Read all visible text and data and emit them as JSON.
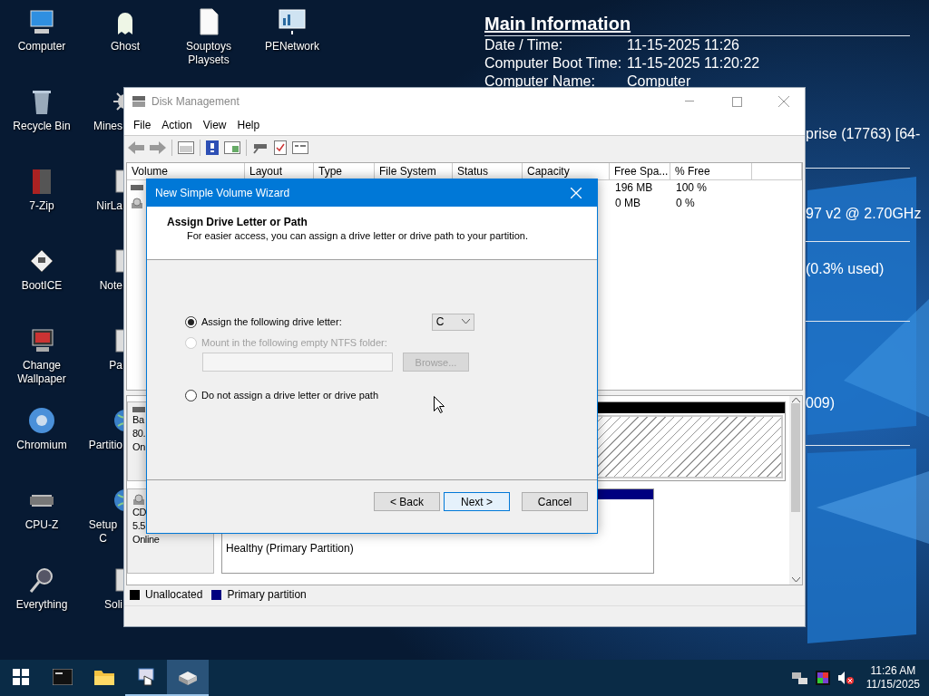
{
  "desktop_columns": [
    {
      "icons": [
        {
          "label": "Computer",
          "kind": "monitor",
          "covered": false
        },
        {
          "label": "Recycle Bin",
          "kind": "bin",
          "covered": false
        },
        {
          "label": "7-Zip",
          "kind": "archive",
          "covered": false
        },
        {
          "label": "BootICE",
          "kind": "floppy",
          "covered": false
        },
        {
          "label": "Change Wallpaper",
          "kind": "wallpaper",
          "covered": false
        },
        {
          "label": "Chromium",
          "kind": "browser",
          "covered": false
        },
        {
          "label": "CPU-Z",
          "kind": "chip",
          "covered": false
        },
        {
          "label": "Everything",
          "kind": "magnifier",
          "covered": false
        }
      ]
    },
    {
      "icons": [
        {
          "label": "Ghost",
          "kind": "ghost",
          "covered": false
        },
        {
          "label": "Mines",
          "kind": "mine",
          "covered": true
        },
        {
          "label": "NirLa",
          "kind": "app",
          "covered": true
        },
        {
          "label": "Note",
          "kind": "app",
          "covered": true
        },
        {
          "label": "Pa",
          "kind": "app",
          "covered": true
        },
        {
          "label": "Partitio",
          "kind": "globe",
          "covered": true
        },
        {
          "label": "Setup C",
          "kind": "globe",
          "covered": true
        },
        {
          "label": "Soli",
          "kind": "app",
          "covered": true
        }
      ]
    },
    {
      "icons": [
        {
          "label": "Souptoys Playsets",
          "kind": "document",
          "covered": false
        }
      ]
    },
    {
      "icons": [
        {
          "label": "PENetwork",
          "kind": "network",
          "covered": false
        }
      ]
    }
  ],
  "info": {
    "title": "Main Information",
    "rows": [
      {
        "label": "Date / Time:",
        "value": "11-15-2025 11:26"
      },
      {
        "label": "Computer Boot Time:",
        "value": "11-15-2025 11:20:22"
      },
      {
        "label": "Computer Name:",
        "value": "Computer"
      }
    ],
    "fragments": [
      "prise (17763) [64-",
      "97 v2 @ 2.70GHz",
      "(0.3% used)",
      "009)"
    ]
  },
  "disk_management": {
    "title": "Disk Management",
    "menu": [
      "File",
      "Action",
      "View",
      "Help"
    ],
    "columns": [
      "Volume",
      "Layout",
      "Type",
      "File System",
      "Status",
      "Capacity",
      "Free Spa...",
      "% Free"
    ],
    "rows": [
      {
        "kind": "disk",
        "free_space": "196 MB",
        "percent_free": "100 %"
      },
      {
        "kind": "cdrom",
        "free_space": "0 MB",
        "percent_free": "0 %"
      }
    ],
    "disks": [
      {
        "kind": "disk",
        "lines": [
          "Ba",
          "80.",
          "On"
        ],
        "partition": {
          "kind": "unallocated"
        }
      },
      {
        "kind": "cdrom",
        "lines": [
          "CD",
          "5.5",
          "Online"
        ],
        "partition": {
          "kind": "primary",
          "status": "Healthy (Primary Partition)"
        }
      }
    ],
    "legend": [
      {
        "label": "Unallocated",
        "color": "#000000"
      },
      {
        "label": "Primary partition",
        "color": "#000080"
      }
    ]
  },
  "wizard": {
    "title": "New Simple Volume Wizard",
    "heading": "Assign Drive Letter or Path",
    "subtitle": "For easier access, you can assign a drive letter or drive path to your partition.",
    "options": [
      {
        "label": "Assign the following drive letter:",
        "selected": true,
        "disabled": false
      },
      {
        "label": "Mount in the following empty NTFS folder:",
        "selected": false,
        "disabled": true
      },
      {
        "label": "Do not assign a drive letter or drive path",
        "selected": false,
        "disabled": false
      }
    ],
    "drive_letter": {
      "value": "C"
    },
    "folder_field": {
      "disabled": true
    },
    "browse_button": {
      "label": "Browse...",
      "disabled": true
    },
    "buttons": [
      {
        "label": "< Back",
        "default": false
      },
      {
        "label": "Next >",
        "default": true
      },
      {
        "label": "Cancel",
        "default": false
      }
    ]
  },
  "taskbar": {
    "apps": [
      {
        "kind": "terminal",
        "running": false,
        "selected": false
      },
      {
        "kind": "folder",
        "running": false,
        "selected": false
      },
      {
        "kind": "disk-tool",
        "running": true,
        "selected": false
      },
      {
        "kind": "drive",
        "running": true,
        "selected": true
      }
    ],
    "time": "11:26 AM",
    "date": "11/15/2025"
  }
}
